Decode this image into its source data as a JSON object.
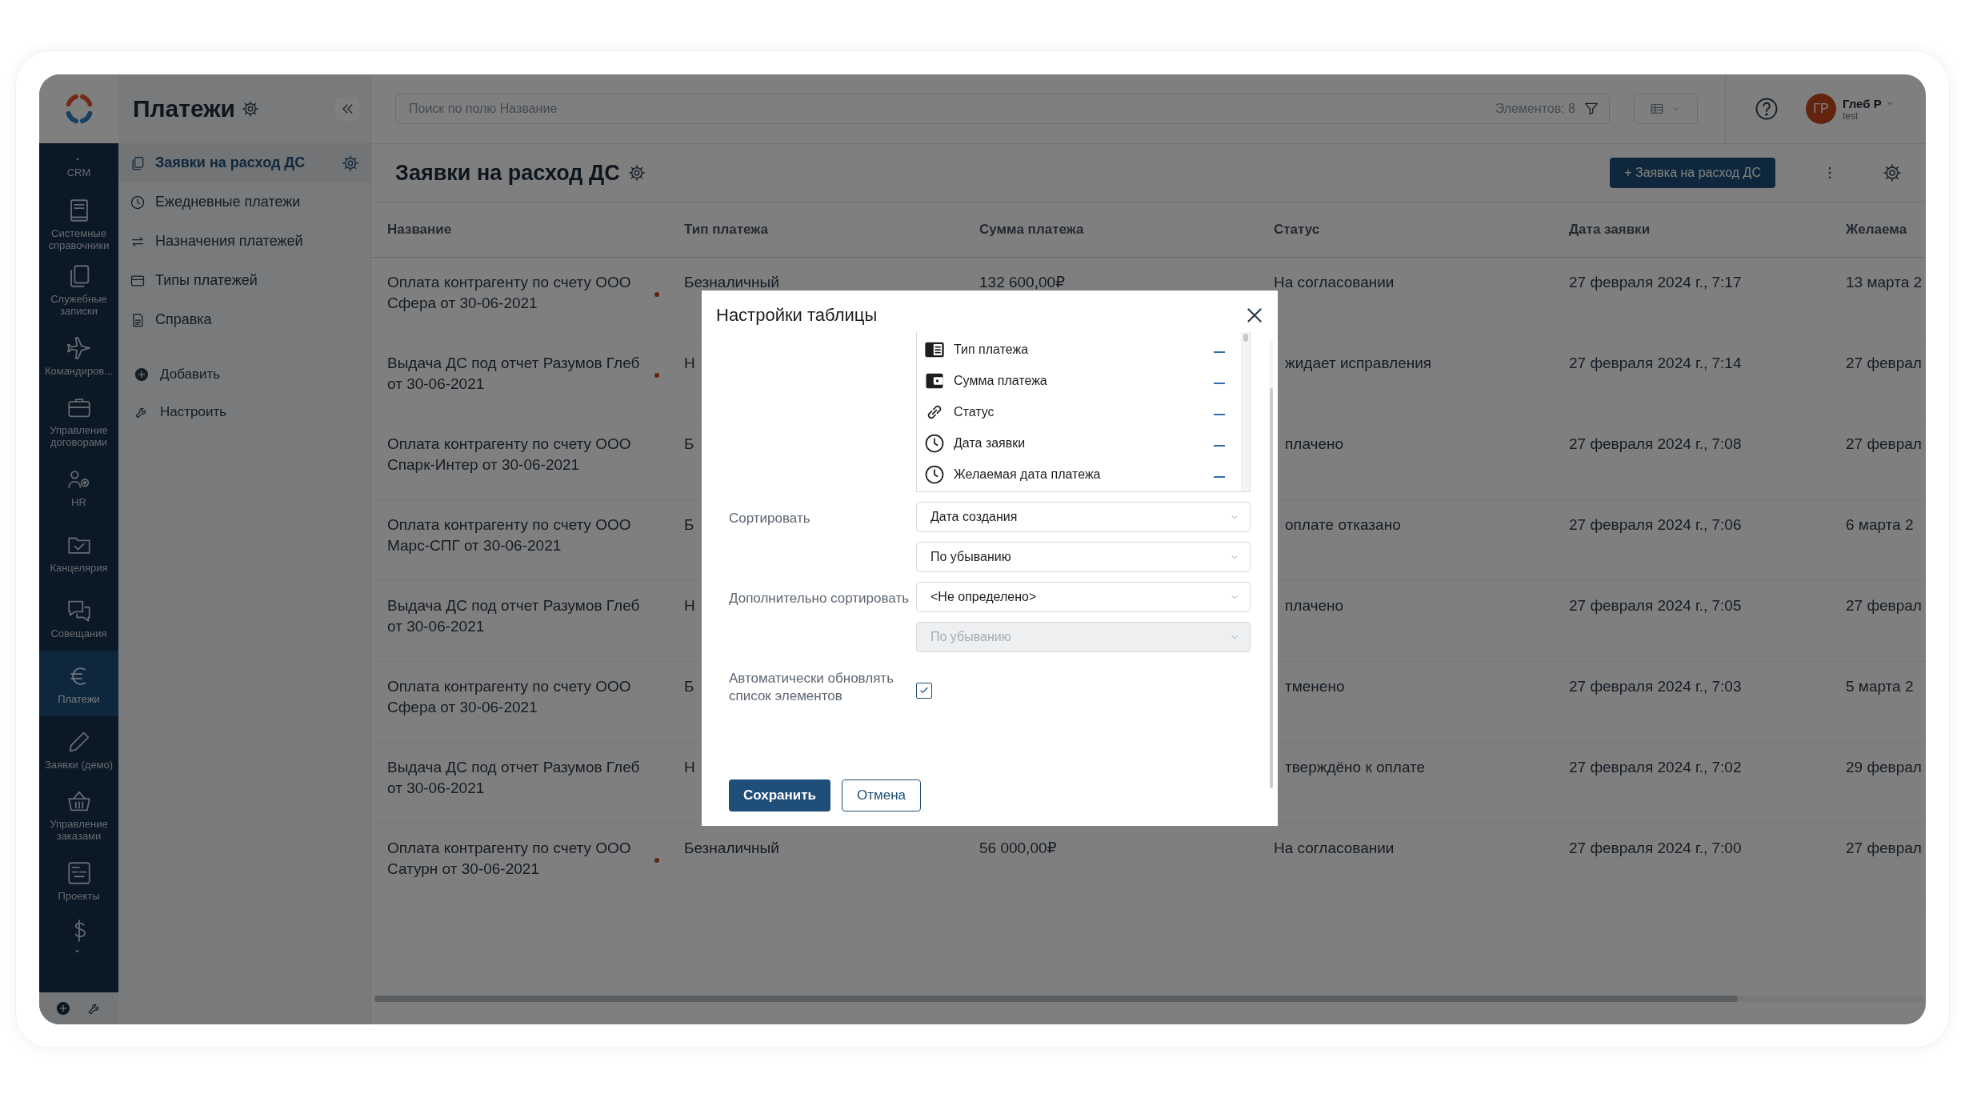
{
  "rail": {
    "items": [
      {
        "label": "CRM",
        "selected": false
      },
      {
        "label": "Системные справочники",
        "selected": false
      },
      {
        "label": "Служебные записки",
        "selected": false
      },
      {
        "label": "Командиров...",
        "selected": false
      },
      {
        "label": "Управление договорами",
        "selected": false
      },
      {
        "label": "HR",
        "selected": false
      },
      {
        "label": "Канцелярия",
        "selected": false
      },
      {
        "label": "Совещания",
        "selected": false
      },
      {
        "label": "Платежи",
        "selected": true
      },
      {
        "label": "Заявки (демо)",
        "selected": false
      },
      {
        "label": "Управление заказами",
        "selected": false
      },
      {
        "label": "Проекты",
        "selected": false
      }
    ]
  },
  "panel": {
    "title": "Платежи",
    "items": [
      {
        "label": "Заявки на расход ДС",
        "selected": true
      },
      {
        "label": "Ежедневные платежи",
        "selected": false
      },
      {
        "label": "Назначения платежей",
        "selected": false
      },
      {
        "label": "Типы платежей",
        "selected": false
      },
      {
        "label": "Справка",
        "selected": false
      }
    ],
    "actions": [
      "Добавить",
      "Настроить"
    ]
  },
  "topbar": {
    "search": {
      "placeholder": "Поиск по полю Название"
    },
    "count": "Элементов: 8",
    "user": {
      "initials": "ГР",
      "name": "Глеб Р",
      "login": "test"
    }
  },
  "page": {
    "title": "Заявки на расход ДС",
    "create_button": "+ Заявка на расход ДС"
  },
  "table": {
    "columns": [
      "Название",
      "Тип платежа",
      "Сумма платежа",
      "Статус",
      "Дата заявки",
      "Желаема"
    ],
    "rows": [
      {
        "name": "Оплата контрагенту по счету ООО Сфера от 30-06-2021",
        "flag": true,
        "behind_dialog": false,
        "type": "Безналичный",
        "sum": "132 600,00₽",
        "status": "На согласовании",
        "date": "27 февраля 2024 г., 7:17",
        "desired": "13 марта 2"
      },
      {
        "name": "Выдача ДС под отчет Разумов Глеб от 30-06-2021",
        "flag": true,
        "behind_dialog": true,
        "type": "Н",
        "status": "жидает исправления",
        "date": "27 февраля 2024 г., 7:14",
        "desired": "27 феврал"
      },
      {
        "name": "Оплата контрагенту по счету ООО Спарк-Интер от 30-06-2021",
        "flag": false,
        "behind_dialog": true,
        "type": "Б",
        "status": "плачено",
        "date": "27 февраля 2024 г., 7:08",
        "desired": "27 феврал"
      },
      {
        "name": "Оплата контрагенту по счету ООО Марс-СПГ от 30-06-2021",
        "flag": false,
        "behind_dialog": true,
        "type": "Б",
        "status": "оплате отказано",
        "date": "27 февраля 2024 г., 7:06",
        "desired": "6 марта 2"
      },
      {
        "name": "Выдача ДС под отчет Разумов Глеб от 30-06-2021",
        "flag": false,
        "behind_dialog": true,
        "type": "Н",
        "status": "плачено",
        "date": "27 февраля 2024 г., 7:05",
        "desired": "27 феврал"
      },
      {
        "name": "Оплата контрагенту по счету ООО Сфера от 30-06-2021",
        "flag": false,
        "behind_dialog": true,
        "type": "Б",
        "status": "тменено",
        "date": "27 февраля 2024 г., 7:03",
        "desired": "5 марта 2"
      },
      {
        "name": "Выдача ДС под отчет Разумов Глеб от 30-06-2021",
        "flag": false,
        "behind_dialog": true,
        "type": "Н",
        "status": "тверждёно к оплате",
        "date": "27 февраля 2024 г., 7:02",
        "desired": "29 феврал"
      },
      {
        "name": "Оплата контрагенту по счету ООО Сатурн от 30-06-2021",
        "flag": true,
        "behind_dialog": false,
        "type": "Безналичный",
        "sum": "56 000,00₽",
        "status": "На согласовании",
        "date": "27 февраля 2024 г., 7:00",
        "desired": "27 феврал"
      }
    ]
  },
  "dialog": {
    "title": "Настройки таблицы",
    "columns_list": [
      {
        "label": "Тип платежа"
      },
      {
        "label": "Сумма платежа"
      },
      {
        "label": "Статус"
      },
      {
        "label": "Дата заявки"
      },
      {
        "label": "Желаемая дата платежа"
      }
    ],
    "sort": {
      "label": "Сортировать",
      "fields": [
        {
          "value": "Дата создания",
          "disabled": false
        },
        {
          "value": "По убыванию",
          "disabled": false
        }
      ]
    },
    "extra_sort": {
      "label": "Дополнительно сортировать",
      "fields": [
        {
          "value": "<Не определено>",
          "disabled": false
        },
        {
          "value": "По убыванию",
          "disabled": true
        }
      ]
    },
    "auto_refresh": {
      "label": "Автоматически обновлять список элементов",
      "checked": true
    },
    "buttons": [
      "Сохранить",
      "Отмена"
    ]
  }
}
